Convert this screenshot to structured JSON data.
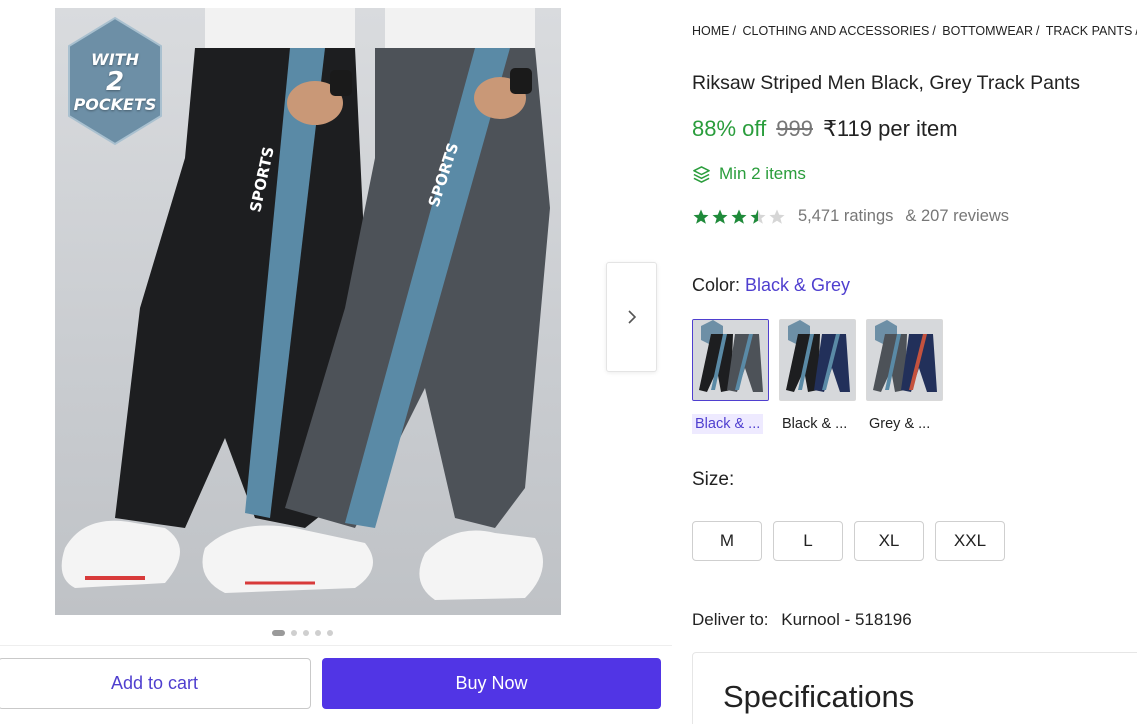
{
  "badge": {
    "line1": "WITH",
    "line2": "2",
    "line3": "POCKETS"
  },
  "carousel": {
    "next_icon": "chevron-right-icon",
    "dots": 5,
    "active_dot": 0
  },
  "actions": {
    "add_to_cart": "Add to cart",
    "buy_now": "Buy Now"
  },
  "breadcrumb": [
    "HOME",
    "CLOTHING AND ACCESSORIES",
    "BOTTOMWEAR",
    "TRACK PANTS"
  ],
  "product": {
    "title": "Riksaw Striped Men Black, Grey Track Pants",
    "discount": "88% off",
    "mrp": "999",
    "price": "₹119 per item",
    "min_items": "Min 2 items",
    "rating_value": 3.5,
    "ratings_text": "5,471 ratings",
    "reviews_text": "& 207 reviews"
  },
  "color": {
    "label": "Color:",
    "selected_value": "Black & Grey",
    "options": [
      {
        "label": "Black & ...",
        "selected": true
      },
      {
        "label": "Black & ...",
        "selected": false
      },
      {
        "label": "Grey & ...",
        "selected": false
      }
    ]
  },
  "size": {
    "label": "Size:",
    "options": [
      "M",
      "L",
      "XL",
      "XXL"
    ]
  },
  "delivery": {
    "label": "Deliver to:",
    "location": "Kurnool - 518196"
  },
  "specifications": {
    "title": "Specifications"
  },
  "colors": {
    "accent": "#5135e5",
    "green": "#2a9d3c",
    "link": "#4f3fcf"
  }
}
